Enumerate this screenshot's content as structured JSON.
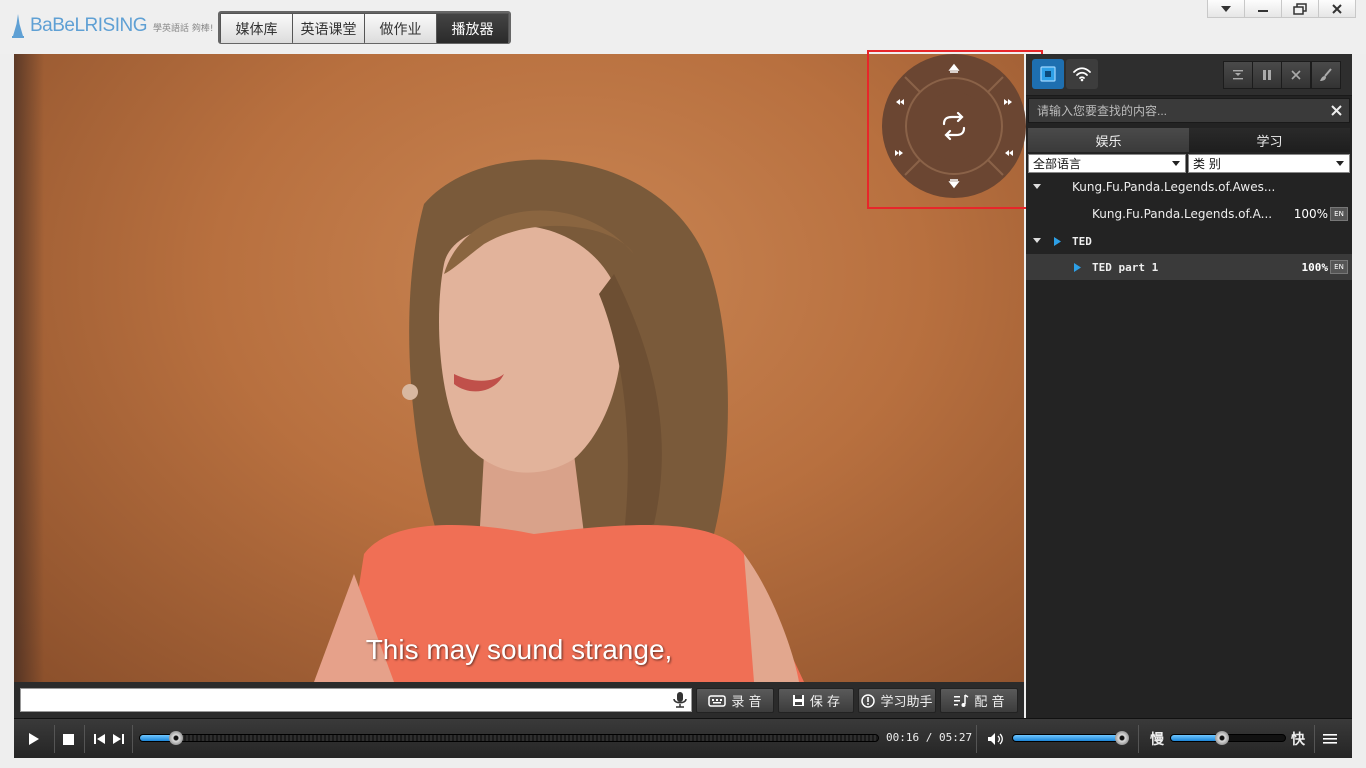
{
  "app": {
    "brand": "BaBeLRISING",
    "tagline": "學英語話 夠棒!"
  },
  "nav": {
    "tabs": [
      {
        "label": "媒体库",
        "active": false
      },
      {
        "label": "英语课堂",
        "active": false
      },
      {
        "label": "做作业",
        "active": false
      },
      {
        "label": "播放器",
        "active": true
      }
    ]
  },
  "window_controls": [
    "menu-icon",
    "minimize-icon",
    "restore-icon",
    "close-icon"
  ],
  "video": {
    "subtitle": "This may sound strange,"
  },
  "input_bar": {
    "value": "",
    "record_label": "录 音",
    "save_label": "保 存",
    "assistant_label": "学习助手",
    "dub_label": "配 音"
  },
  "player": {
    "time_current": "00:16",
    "time_separator": "/",
    "time_total": "05:27",
    "progress": 0.049,
    "volume": 0.97,
    "speed": 0.45,
    "slow_label": "慢",
    "fast_label": "快"
  },
  "panel": {
    "search_placeholder": "请输入您要查找的内容...",
    "cat_tabs": [
      "娱乐",
      "学习"
    ],
    "language_select": "全部语言",
    "category_select": "类 别",
    "tree": [
      {
        "label": "Kung.Fu.Panda.Legends.of.Awes...",
        "level": 0
      },
      {
        "label": "Kung.Fu.Panda.Legends.of.A...",
        "level": 1,
        "percent": "100%",
        "badge": "EN"
      },
      {
        "label": "TED",
        "level": 0
      },
      {
        "label": "TED part 1",
        "level": 1,
        "percent": "100%",
        "badge": "EN"
      }
    ]
  },
  "colors": {
    "accent": "#2d9fe6",
    "highlight": "#e8262a",
    "wheel": "#6b4632"
  }
}
